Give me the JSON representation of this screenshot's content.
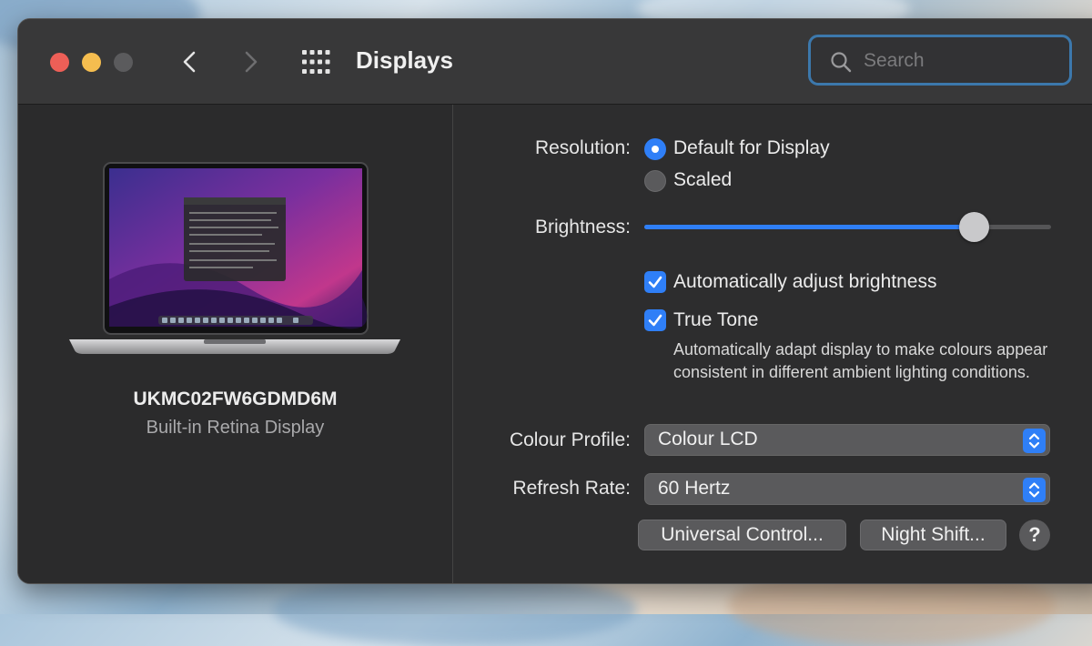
{
  "window": {
    "title": "Displays",
    "search": {
      "placeholder": "Search"
    }
  },
  "colors": {
    "close": "#ed5f57",
    "minimize": "#f5bd4f",
    "maximize": "#5b5b5d",
    "accent": "#2f7ff7",
    "focus_ring": "#3c78ac"
  },
  "toolbar": {
    "back_icon": "chevron-left-icon",
    "forward_icon": "chevron-right-icon",
    "grid_icon": "show-all-grid-icon"
  },
  "display": {
    "name": "UKMC02FW6GDMD6M",
    "type": "Built-in Retina Display"
  },
  "settings": {
    "resolution": {
      "label": "Resolution:",
      "options": [
        {
          "label": "Default for Display",
          "selected": true
        },
        {
          "label": "Scaled",
          "selected": false
        }
      ]
    },
    "brightness": {
      "label": "Brightness:",
      "value": 0.81
    },
    "auto_brightness": {
      "label": "Automatically adjust brightness",
      "checked": true
    },
    "true_tone": {
      "label": "True Tone",
      "checked": true,
      "description": "Automatically adapt display to make colours appear consistent in different ambient lighting conditions."
    },
    "colour_profile": {
      "label": "Colour Profile:",
      "value": "Colour LCD"
    },
    "refresh_rate": {
      "label": "Refresh Rate:",
      "value": "60 Hertz"
    }
  },
  "buttons": {
    "universal_control": "Universal Control...",
    "night_shift": "Night Shift...",
    "help": "?"
  }
}
